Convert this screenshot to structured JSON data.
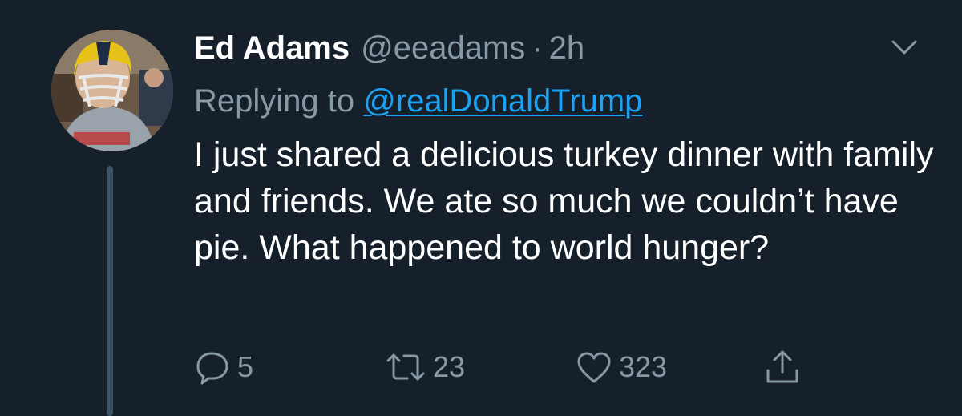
{
  "tweet": {
    "author_name": "Ed Adams",
    "author_handle": "@eeadams",
    "separator": "·",
    "timestamp": "2h",
    "replying_prefix": "Replying to ",
    "replying_to": "@realDonaldTrump",
    "text": "I just shared a delicious turkey dinner with family and friends. We ate so much we couldn’t have pie. What happened to world hunger?"
  },
  "actions": {
    "reply_count": "5",
    "retweet_count": "23",
    "like_count": "323"
  },
  "icons": {
    "menu": "chevron-down-icon",
    "reply": "reply-icon",
    "retweet": "retweet-icon",
    "like": "heart-icon",
    "share": "share-icon"
  },
  "colors": {
    "background": "#15202b",
    "primary_text": "#ffffff",
    "secondary_text": "#8899a6",
    "link": "#1da1f2",
    "thread_line": "#3d5466"
  }
}
